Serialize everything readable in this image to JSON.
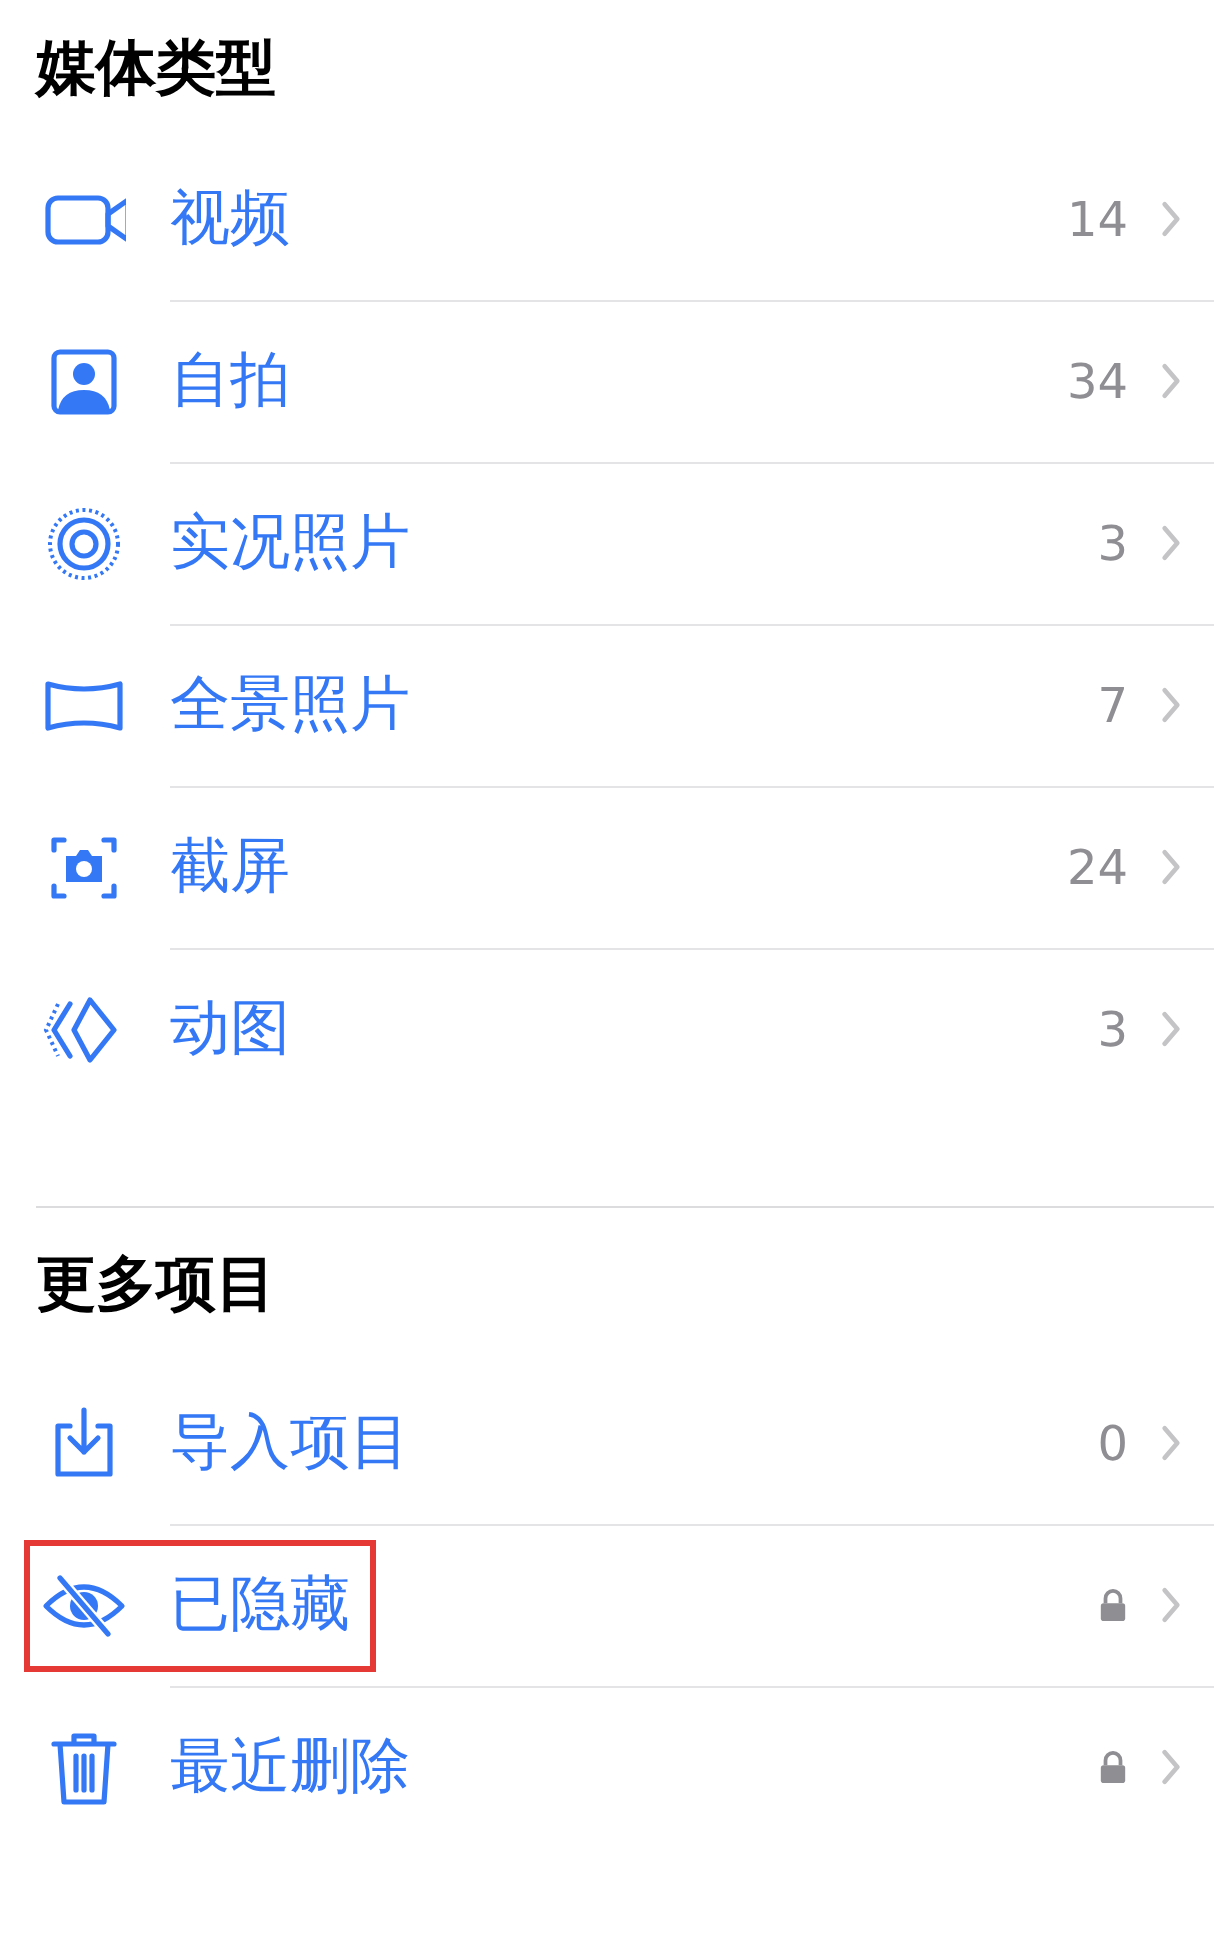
{
  "sections": [
    {
      "title": "媒体类型",
      "items": [
        {
          "label": "视频",
          "count": "14",
          "locked": false,
          "highlighted": false
        },
        {
          "label": "自拍",
          "count": "34",
          "locked": false,
          "highlighted": false
        },
        {
          "label": "实况照片",
          "count": "3",
          "locked": false,
          "highlighted": false
        },
        {
          "label": "全景照片",
          "count": "7",
          "locked": false,
          "highlighted": false
        },
        {
          "label": "截屏",
          "count": "24",
          "locked": false,
          "highlighted": false
        },
        {
          "label": "动图",
          "count": "3",
          "locked": false,
          "highlighted": false
        }
      ]
    },
    {
      "title": "更多项目",
      "items": [
        {
          "label": "导入项目",
          "count": "0",
          "locked": false,
          "highlighted": false
        },
        {
          "label": "已隐藏",
          "locked": true,
          "highlighted": true
        },
        {
          "label": "最近删除",
          "locked": true,
          "highlighted": false
        }
      ]
    }
  ]
}
